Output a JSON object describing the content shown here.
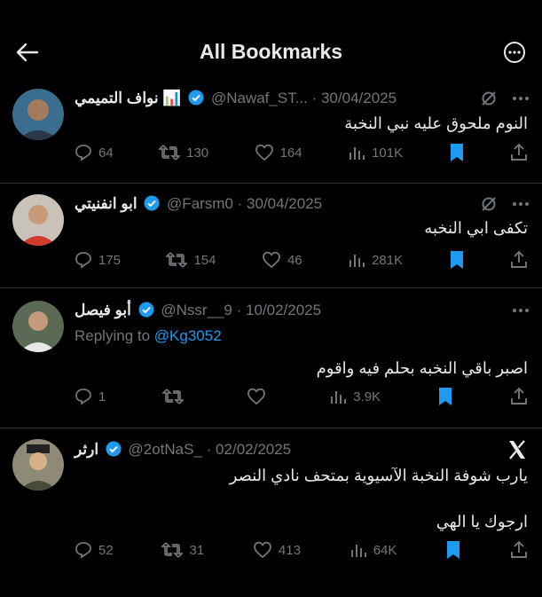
{
  "header": {
    "title": "All Bookmarks"
  },
  "colors": {
    "accent": "#1d9bf0",
    "muted": "#71767b",
    "text": "#e7e9ea",
    "divider": "#2f3336"
  },
  "tweets": [
    {
      "name": "نواف التميمي",
      "name_suffix": "📊",
      "handle": "@Nawaf_ST...",
      "date": "· 30/04/2025",
      "text": "النوم ملحوق عليه نبي النخبة",
      "replies": "64",
      "retweets": "130",
      "likes": "164",
      "views": "101K"
    },
    {
      "name": "ابو انفنيتي",
      "handle": "@Farsm0",
      "date": "· 30/04/2025",
      "text": "تكفى ابي النخبه",
      "replies": "175",
      "retweets": "154",
      "likes": "46",
      "views": "281K"
    },
    {
      "name": "أبو فيصل",
      "handle": "@Nssr__9",
      "date": "· 10/02/2025",
      "replying_prefix": "Replying to",
      "replying_handle": "@Kg3052",
      "text": "اصبر باقي النخبه بحلم فيه واقوم",
      "replies": "1",
      "retweets": "",
      "likes": "",
      "views": "3.9K"
    },
    {
      "name": "ارثر",
      "handle": "@2otNaS_",
      "date": "· 02/02/2025",
      "text": "يارب شوفة النخبة الآسيوية بمتحف نادي النصر",
      "text2": "ارجوك يا الهي",
      "replies": "52",
      "retweets": "31",
      "likes": "413",
      "views": "64K"
    }
  ]
}
